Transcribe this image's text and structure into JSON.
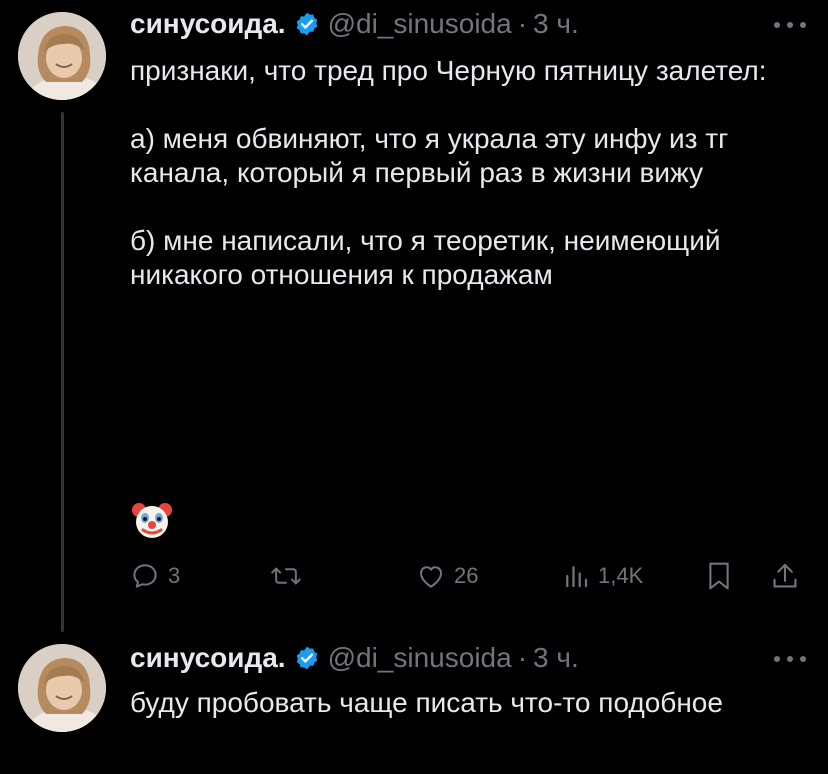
{
  "tweets": [
    {
      "author": {
        "name": "синусоида.",
        "handle": "@di_sinusoida",
        "separator": "·",
        "time": "3 ч."
      },
      "text": "признаки, что тред про Черную пятницу залетел:\n\nа) меня обвиняют, что я украла эту инфу из тг канала, который я первый раз в жизни вижу\n\nб) мне написали, что я теоретик, неимеющий никакого отношения к продажам",
      "emoji": "clown-face",
      "actions": {
        "replies": "3",
        "retweets": "",
        "likes": "26",
        "views": "1,4K"
      }
    },
    {
      "author": {
        "name": "синусоида.",
        "handle": "@di_sinusoida",
        "separator": "·",
        "time": "3 ч."
      },
      "text": "буду пробовать чаще писать что-то подобное"
    }
  ],
  "icons": {
    "verified": "verified-badge-icon",
    "more": "more-options-icon",
    "reply": "reply-icon",
    "retweet": "retweet-icon",
    "like": "like-icon",
    "views": "views-icon",
    "bookmark": "bookmark-icon",
    "share": "share-icon"
  },
  "colors": {
    "background": "#000000",
    "text": "#e7e9ea",
    "secondary": "#71767b",
    "verified": "#1d9bf0",
    "thread_line": "#333639"
  }
}
